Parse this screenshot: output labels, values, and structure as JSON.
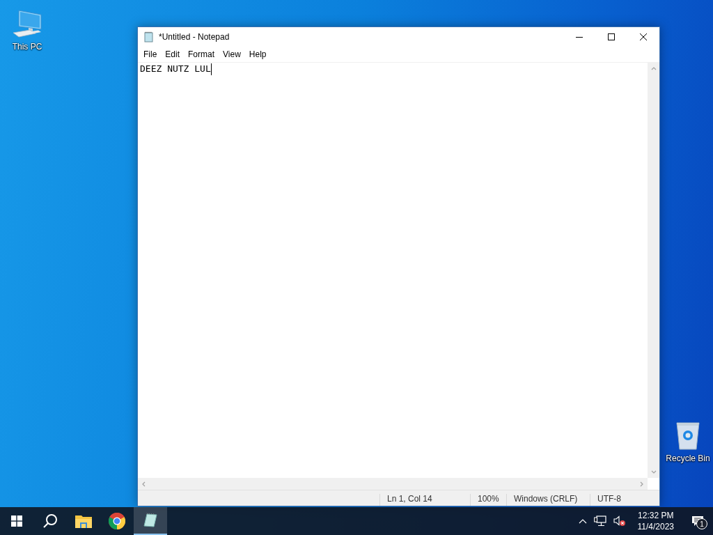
{
  "desktop_icons": [
    {
      "kind": "computer",
      "label": "This PC"
    },
    {
      "kind": "recycle",
      "label": "Recycle Bin"
    }
  ],
  "window": {
    "title": "*Untitled - Notepad",
    "menu": [
      "File",
      "Edit",
      "Format",
      "View",
      "Help"
    ],
    "text": "DEEZ NUTZ LUL",
    "status_bar": [
      "Ln 1, Col 14",
      "100%",
      "Windows (CRLF)",
      "UTF-8"
    ]
  },
  "taskbar": {
    "apps": [
      {
        "kind": "explorer",
        "selected": false
      },
      {
        "kind": "chrome",
        "selected": false
      },
      {
        "kind": "notepad",
        "selected": true
      }
    ],
    "clock": {
      "time": "12:32 PM",
      "date": "11/4/2023"
    },
    "notifications": "1"
  }
}
